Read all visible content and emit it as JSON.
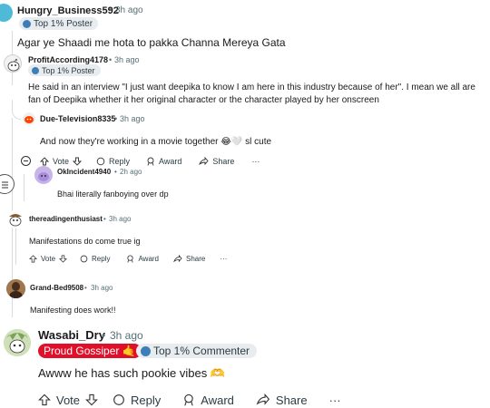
{
  "comments": {
    "c1": {
      "username": "Hungry_Business592",
      "time": "3h ago",
      "flair": "Top 1% Poster",
      "text": "Agar ye Shaadi me hota to pakka Channa Mereya Gata"
    },
    "c2": {
      "username": "ProfitAccording4178",
      "time": "3h ago",
      "flair": "Top 1% Poster",
      "text": "He said in an interview \"I just want deepika to know I am here in this industry because of her\". I mean we all are fan of Deepika whether it her original character or the character played by her onscreen"
    },
    "c3": {
      "username": "Due-Television8335",
      "time": "3h ago",
      "text": "And now they're working in a movie together 😂🤍 sl cute",
      "actions": {
        "vote": "Vote",
        "reply": "Reply",
        "award": "Award",
        "share": "Share",
        "more": "···"
      }
    },
    "c4": {
      "username": "OkIncident4940",
      "time": "2h ago",
      "text": "Bhai literally fanboying over dp"
    },
    "c5": {
      "username": "thereadingenthusiast",
      "time": "3h ago",
      "text": "Manifestations do come true ig",
      "actions": {
        "vote": "Vote",
        "reply": "Reply",
        "award": "Award",
        "share": "Share",
        "more": "···"
      }
    },
    "c6": {
      "username": "Grand-Bed9508",
      "time": "3h ago",
      "text": "Manifesting does work!!"
    },
    "c7": {
      "username": "Wasabi_Dry",
      "time": "3h ago",
      "flair1": "Proud Gossiper 🤙",
      "flair2": "Top 1% Commenter",
      "text": "Awww he has such pookie vibes 🫶",
      "actions": {
        "vote": "Vote",
        "reply": "Reply",
        "award": "Award",
        "share": "Share",
        "more": "···"
      }
    }
  },
  "sep": "•",
  "colors": {
    "proud_flair_bg": "#e0102a",
    "flair_bg": "#e8ecef",
    "meta": "#576f76"
  }
}
